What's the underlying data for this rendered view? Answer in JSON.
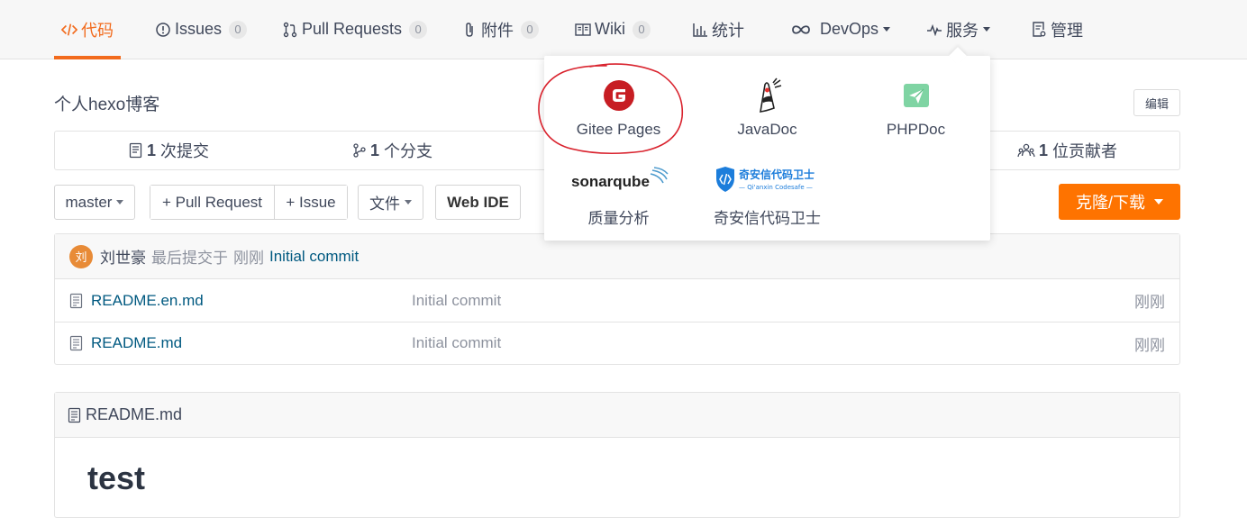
{
  "tabs": [
    {
      "label": "代码",
      "icon": "code-icon",
      "active": true
    },
    {
      "label": "Issues",
      "icon": "issue-icon",
      "count": "0"
    },
    {
      "label": "Pull Requests",
      "icon": "pull-request-icon",
      "count": "0"
    },
    {
      "label": "附件",
      "icon": "paperclip-icon",
      "count": "0"
    },
    {
      "label": "Wiki",
      "icon": "book-icon",
      "count": "0"
    },
    {
      "label": "统计",
      "icon": "bar-chart-icon"
    },
    {
      "label": "DevOps",
      "icon": "infinity-icon"
    },
    {
      "label": "服务",
      "icon": "pulse-icon"
    },
    {
      "label": "管理",
      "icon": "settings-doc-icon"
    }
  ],
  "repo": {
    "description": "个人hexo博客",
    "edit_label": "编辑"
  },
  "stats": {
    "commits": {
      "count": "1",
      "label": "次提交"
    },
    "branches": {
      "count": "1",
      "label": "个分支"
    },
    "contributors": {
      "count": "1",
      "label": "位贡献者"
    }
  },
  "toolbar": {
    "branch": "master",
    "pull_request": "+ Pull Request",
    "issue": "+ Issue",
    "file": "文件",
    "web_ide": "Web IDE",
    "clone": "克隆/下载"
  },
  "last_commit": {
    "avatar_text": "刘",
    "author": "刘世豪",
    "action": "最后提交于",
    "time": "刚刚",
    "message": "Initial commit"
  },
  "files": [
    {
      "name": "README.en.md",
      "message": "Initial commit",
      "time": "刚刚"
    },
    {
      "name": "README.md",
      "message": "Initial commit",
      "time": "刚刚"
    }
  ],
  "readme": {
    "filename": "README.md",
    "heading": "test"
  },
  "services_menu": {
    "items": [
      {
        "label": "Gitee Pages",
        "logo": "gitee-logo"
      },
      {
        "label": "JavaDoc",
        "logo": "java-duke-logo"
      },
      {
        "label": "PHPDoc",
        "logo": "phpdoc-logo"
      },
      {
        "label": "质量分析",
        "logo": "sonarqube-logo",
        "logo_text": "sonarqube"
      },
      {
        "label": "奇安信代码卫士",
        "logo": "qianxin-logo",
        "logo_text": "奇安信代码卫士",
        "logo_subtext": "— Qi'anxin Codesafe —"
      }
    ]
  },
  "colors": {
    "accent": "#f26b1d",
    "clone_button": "#fe7300",
    "link": "#005980",
    "annotation": "#d9232e"
  }
}
